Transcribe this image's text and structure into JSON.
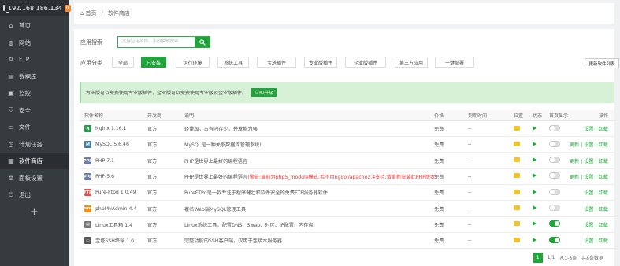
{
  "sidebar": {
    "host": "192.168.186.134",
    "badge": "0",
    "items": [
      {
        "label": "首页",
        "icon": "home-icon",
        "glyph": "⌂"
      },
      {
        "label": "网站",
        "icon": "globe-icon",
        "glyph": "◍"
      },
      {
        "label": "FTP",
        "icon": "ftp-icon",
        "glyph": "⇅"
      },
      {
        "label": "数据库",
        "icon": "database-icon",
        "glyph": "▤"
      },
      {
        "label": "监控",
        "icon": "monitor-icon",
        "glyph": "▣"
      },
      {
        "label": "安全",
        "icon": "shield-icon",
        "glyph": "⛉"
      },
      {
        "label": "文件",
        "icon": "folder-icon",
        "glyph": "▭"
      },
      {
        "label": "计划任务",
        "icon": "clock-icon",
        "glyph": "◷"
      },
      {
        "label": "软件商店",
        "icon": "store-icon",
        "glyph": "▦"
      },
      {
        "label": "面板设置",
        "icon": "gear-icon",
        "glyph": "⚙"
      },
      {
        "label": "退出",
        "icon": "exit-icon",
        "glyph": "⏻"
      }
    ],
    "add": "+"
  },
  "breadcrumb": {
    "home": "首页",
    "sep": "/",
    "current": "软件商店"
  },
  "search": {
    "label": "应用搜索",
    "placeholder": "支持应用名称、字段模糊搜索",
    "icon": "search-icon"
  },
  "categories": {
    "label": "应用分类",
    "items": [
      "全部",
      "已安装",
      "运行环境",
      "系统工具",
      "宝塔插件",
      "专业版插件",
      "企业版插件",
      "第三方应用",
      "一键部署"
    ],
    "active": "已安装",
    "refresh": "更新软件列表"
  },
  "notice": {
    "text": "专业版可以免费使用专业版插件，企业版可以免费使用专业版及企业版插件。",
    "button": "立即升级"
  },
  "table": {
    "headers": [
      "软件名称",
      "开发商",
      "说明",
      "价格",
      "到期时间",
      "位置",
      "状态",
      "首页显示",
      "操作"
    ],
    "rows": [
      {
        "name": "Nginx 1.16.1",
        "icon_color": "#209e45",
        "icon_text": "N",
        "vendor": "官方",
        "desc": "轻量级，占有内存少，并发能力强",
        "desc_red": "",
        "price": "免费",
        "expiry": "--",
        "home": false,
        "actions": "设置 | 卸载"
      },
      {
        "name": "MySQL 5.6.46",
        "icon_color": "#4479a1",
        "icon_text": "M",
        "vendor": "官方",
        "desc": "MySQL是一种关系数据库管理系统!",
        "desc_red": "",
        "price": "免费",
        "expiry": "--",
        "home": false,
        "actions": "更新 | 设置 | 卸载"
      },
      {
        "name": "PHP-7.1",
        "icon_color": "#6b7bb3",
        "icon_text": "php",
        "vendor": "官方",
        "desc": "PHP是世界上最好的编程语言",
        "desc_red": "",
        "price": "免费",
        "expiry": "--",
        "home": false,
        "actions": "更新 | 设置 | 卸载"
      },
      {
        "name": "PHP-5.6",
        "icon_color": "#6b7bb3",
        "icon_text": "php",
        "vendor": "官方",
        "desc": "PHP是世界上最好的编程语言",
        "desc_red": "(警告:当前为php5_module模式,若不用nginx/apache2.4支持,请重新安装此PHP版本)",
        "price": "免费",
        "expiry": "--",
        "home": false,
        "actions": "更新 | 设置 | 卸载"
      },
      {
        "name": "Pure-Ftpd 1.0.49",
        "icon_color": "#d9534f",
        "icon_text": "FTP",
        "vendor": "官方",
        "desc": "PureFTPd是一款专注于程序健壮和软件安全的免费FTP服务器软件",
        "desc_red": "",
        "price": "免费",
        "expiry": "--",
        "home": false,
        "actions": "设置 | 卸载"
      },
      {
        "name": "phpMyAdmin 4.4",
        "icon_color": "#f29111",
        "icon_text": "pma",
        "vendor": "官方",
        "desc": "著名Web端MySQL管理工具",
        "desc_red": "",
        "price": "免费",
        "expiry": "--",
        "home": false,
        "actions": "设置 | 卸载"
      },
      {
        "name": "Linux工具箱 1.4",
        "icon_color": "#777777",
        "icon_text": "▤",
        "vendor": "官方",
        "desc": "Linux系统工具，配置DNS、Swap、时区、IP配置、内存盘!",
        "desc_red": "",
        "price": "免费",
        "expiry": "--",
        "home": true,
        "actions": "设置 | 卸载"
      },
      {
        "name": "宝塔SSH终端 1.0",
        "icon_color": "#555555",
        "icon_text": "▭",
        "vendor": "官方",
        "desc": "完整功能的SSH客户端，仅用于连接本服务器",
        "desc_red": "",
        "price": "免费",
        "expiry": "--",
        "home": true,
        "actions": "设置 | 卸载"
      }
    ]
  },
  "pager": {
    "current": "1",
    "pages": "1/1",
    "range": "从1-8条",
    "total": "共8条数据"
  },
  "colors": {
    "accent": "#20a53a",
    "sidebar": "#363b40",
    "warning": "#ee3333"
  }
}
